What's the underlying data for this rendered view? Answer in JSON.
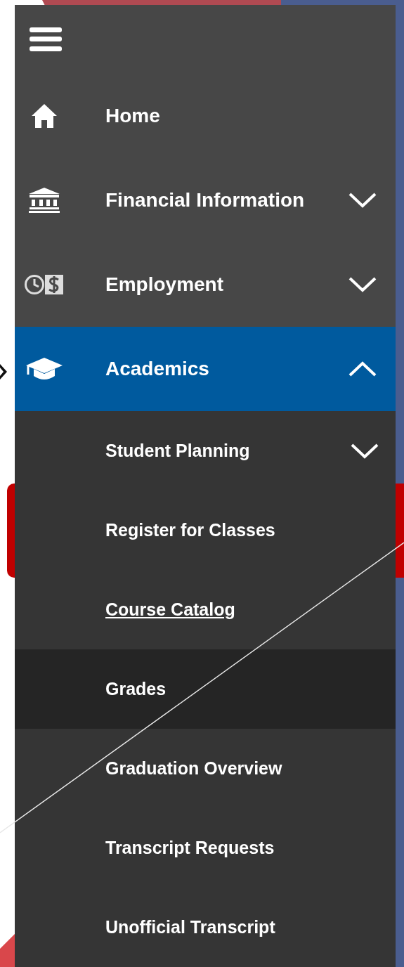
{
  "nav": {
    "items": [
      {
        "label": "Home",
        "selected": false
      },
      {
        "label": "Financial Information",
        "expanded": false,
        "selected": false
      },
      {
        "label": "Employment",
        "expanded": false,
        "selected": false
      },
      {
        "label": "Academics",
        "expanded": true,
        "selected": true,
        "children": [
          {
            "label": "Student Planning",
            "expanded": false,
            "selected": false,
            "focused": false
          },
          {
            "label": "Register for Classes",
            "selected": false,
            "focused": false
          },
          {
            "label": "Course Catalog",
            "selected": false,
            "focused": true
          },
          {
            "label": "Grades",
            "selected": true,
            "focused": false
          },
          {
            "label": "Graduation Overview",
            "selected": false,
            "focused": false
          },
          {
            "label": "Transcript Requests",
            "selected": false,
            "focused": false
          },
          {
            "label": "Unofficial Transcript",
            "selected": false,
            "focused": false
          }
        ]
      }
    ]
  }
}
